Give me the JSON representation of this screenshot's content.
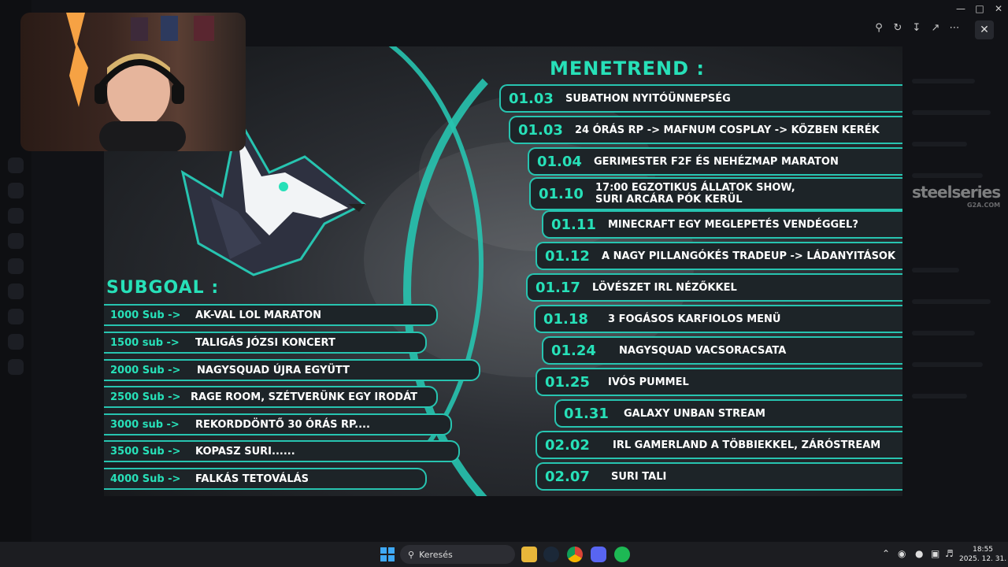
{
  "schedule": {
    "title": "MENETREND :",
    "items": [
      {
        "date": "01.03",
        "event": "SUBATHON NYITÓÜNNEPSÉG"
      },
      {
        "date": "01.03",
        "event": "24 ÓRÁS RP -> MAFNUM COSPLAY -> KÖZBEN KERÉK"
      },
      {
        "date": "01.04",
        "event": "GERIMESTER F2F ÉS NEHÉZMAP MARATON"
      },
      {
        "date": "01.10",
        "event": "17:00 EGZOTIKUS ÁLLATOK SHOW,\nSURI ARCÁRA PÓK KERÜL"
      },
      {
        "date": "01.11",
        "event": "MINECRAFT EGY MEGLEPETÉS VENDÉGGEL?"
      },
      {
        "date": "01.12",
        "event": "A NAGY PILLANGÓKÉS TRADEUP -> LÁDANYITÁSOK"
      },
      {
        "date": "01.17",
        "event": "LÖVÉSZET IRL NÉZŐKKEL"
      },
      {
        "date": "01.18",
        "event": "3 FOGÁSOS KARFIOLOS MENÜ"
      },
      {
        "date": "01.24",
        "event": "NAGYSQUAD VACSORACSATA"
      },
      {
        "date": "01.25",
        "event": "IVÓS PUMMEL"
      },
      {
        "date": "01.31",
        "event": "GALAXY UNBAN STREAM"
      },
      {
        "date": "02.02",
        "event": "IRL GAMERLAND A TÖBBIEKKEL, ZÁRÓSTREAM"
      },
      {
        "date": "02.07",
        "event": "SURI TALI"
      }
    ]
  },
  "subgoal": {
    "title": "SUBGOAL :",
    "items": [
      {
        "goal": "1000 Sub ->",
        "text": "AK-VAL LOL MARATON"
      },
      {
        "goal": "1500 sub ->",
        "text": "TALIGÁS JÓZSI KONCERT"
      },
      {
        "goal": "2000 Sub ->",
        "text": "NAGYSQUAD ÚJRA EGYÜTT"
      },
      {
        "goal": "2500 Sub ->",
        "text": "RAGE ROOM, SZÉTVERÜNK EGY IRODÁT"
      },
      {
        "goal": "3000 sub ->",
        "text": "REKORDDÖNTŐ 30 ÓRÁS RP...."
      },
      {
        "goal": "3500 Sub ->",
        "text": "KOPASZ SURI......"
      },
      {
        "goal": "4000 Sub ->",
        "text": "FALKÁS TETOVÁLÁS"
      }
    ]
  },
  "watermark": {
    "brand": "steelseries",
    "sub": "G2A.COM"
  },
  "taskbar": {
    "search_label": "Keresés",
    "time": "18:55",
    "date": "2025. 12. 31."
  },
  "icons": {
    "viewer": [
      "zoom-in-icon",
      "rotate-icon",
      "download-icon",
      "open-external-icon",
      "more-icon"
    ],
    "close": "close-icon",
    "taskbar_apps": [
      "windows-start-icon",
      "file-explorer-icon",
      "steam-icon",
      "chrome-icon",
      "discord-icon",
      "spotify-icon"
    ]
  },
  "colors": {
    "accent": "#27e0b8",
    "border": "#27c4b0",
    "row_bg": "#1d2428"
  }
}
